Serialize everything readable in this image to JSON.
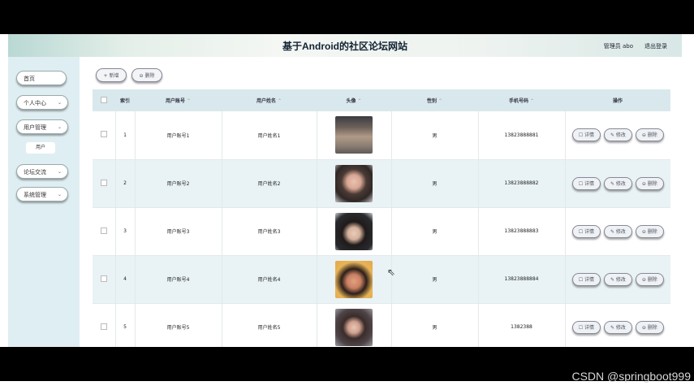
{
  "header": {
    "title": "基于Android的社区论坛网站",
    "user_info": "管理员 abo",
    "logout": "退出登录"
  },
  "sidebar": {
    "items": [
      {
        "label": "首页",
        "chevron": ""
      },
      {
        "label": "个人中心",
        "chevron": "⌄"
      },
      {
        "label": "用户管理",
        "chevron": "⌄"
      },
      {
        "label": "论坛交流",
        "chevron": "⌄"
      },
      {
        "label": "系统管理",
        "chevron": "⌄"
      }
    ],
    "subitem": "用户"
  },
  "toolbar": {
    "add_label": "+ 新增",
    "delete_label": "⊖ 删除"
  },
  "table": {
    "headers": {
      "index": "索引",
      "account": "用户账号",
      "name": "用户姓名",
      "avatar": "头像",
      "gender": "性别",
      "phone": "手机号码",
      "actions": "操作"
    },
    "sort_icon": "⌃",
    "rows": [
      {
        "index": "1",
        "account": "用户账号1",
        "name": "用户姓名1",
        "gender": "男",
        "phone": "13823888881"
      },
      {
        "index": "2",
        "account": "用户账号2",
        "name": "用户姓名2",
        "gender": "男",
        "phone": "13823888882"
      },
      {
        "index": "3",
        "account": "用户账号3",
        "name": "用户姓名3",
        "gender": "男",
        "phone": "13823888883"
      },
      {
        "index": "4",
        "account": "用户账号4",
        "name": "用户姓名4",
        "gender": "男",
        "phone": "13823888884"
      },
      {
        "index": "5",
        "account": "用户账号5",
        "name": "用户姓名5",
        "gender": "男",
        "phone": "1382388"
      }
    ],
    "action_labels": {
      "detail": "☐ 详情",
      "edit": "✎ 修改",
      "delete": "⊖ 删除"
    }
  },
  "watermark": "CSDN @springboot999",
  "colors": {
    "sidebar_bg": "#dfeef2",
    "header_gradient_start": "#b9d8d4",
    "row_alt_bg": "#e9f2f4",
    "thead_bg": "#d9e8ec",
    "letterbox": "#000000"
  },
  "icons": {
    "cursor": "mouse-pointer-icon",
    "chevron": "chevron-down-icon",
    "sort": "sort-icon"
  }
}
